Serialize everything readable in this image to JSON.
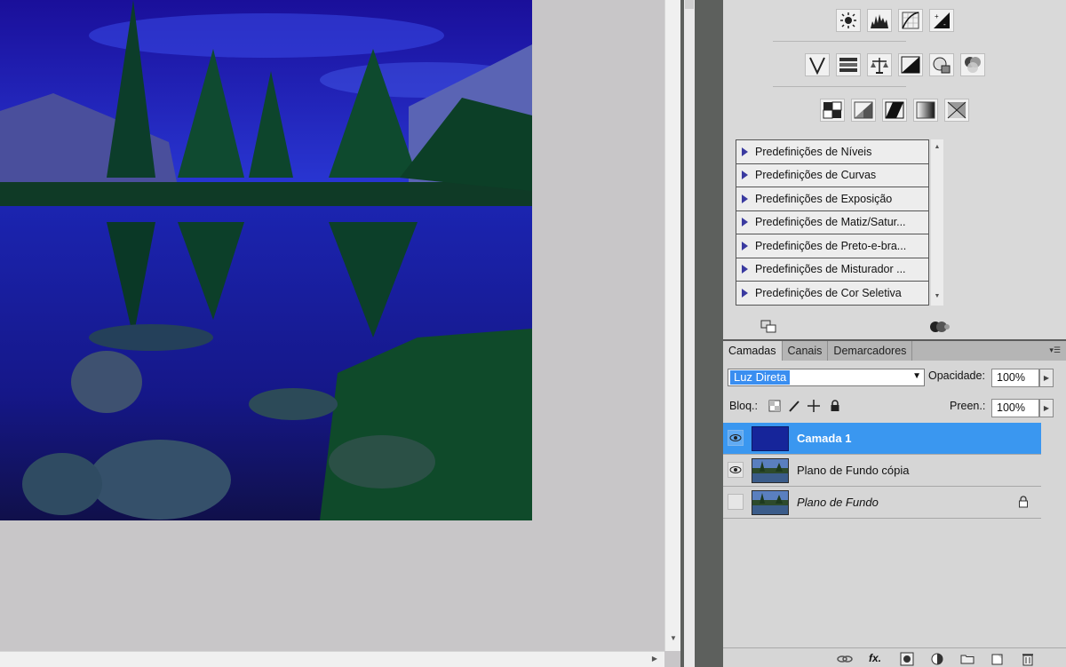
{
  "adjustments": {
    "icon_rows": [
      [
        "brightness-contrast-icon",
        "levels-icon",
        "curves-icon",
        "exposure-icon"
      ],
      [
        "vibrance-icon",
        "hue-saturation-icon",
        "color-balance-icon",
        "black-white-icon",
        "photo-filter-icon",
        "channel-mixer-icon"
      ],
      [
        "invert-icon",
        "posterize-icon",
        "threshold-icon",
        "gradient-map-icon",
        "selective-color-icon"
      ]
    ],
    "presets": [
      "Predefinições de Níveis",
      "Predefinições de Curvas",
      "Predefinições de Exposição",
      "Predefinições de Matiz/Satur...",
      "Predefinições de Preto-e-bra...",
      "Predefinições de Misturador ...",
      "Predefinições de Cor Seletiva"
    ]
  },
  "layers": {
    "tabs": [
      "Camadas",
      "Canais",
      "Demarcadores"
    ],
    "active_tab": "Camadas",
    "blend_mode": "Luz Direta",
    "opacity_label": "Opacidade:",
    "opacity_value": "100%",
    "lock_label": "Bloq.:",
    "fill_label": "Preen.:",
    "fill_value": "100%",
    "items": [
      {
        "name": "Camada 1",
        "visible": true,
        "selected": true,
        "locked": false
      },
      {
        "name": "Plano de Fundo cópia",
        "visible": true,
        "selected": false,
        "locked": false
      },
      {
        "name": "Plano de Fundo",
        "visible": false,
        "selected": false,
        "locked": true
      }
    ]
  },
  "colors": {
    "selection": "#3a97f0",
    "photo_tint": "#1f1fb0",
    "panel_bg": "#d9d9d9"
  }
}
